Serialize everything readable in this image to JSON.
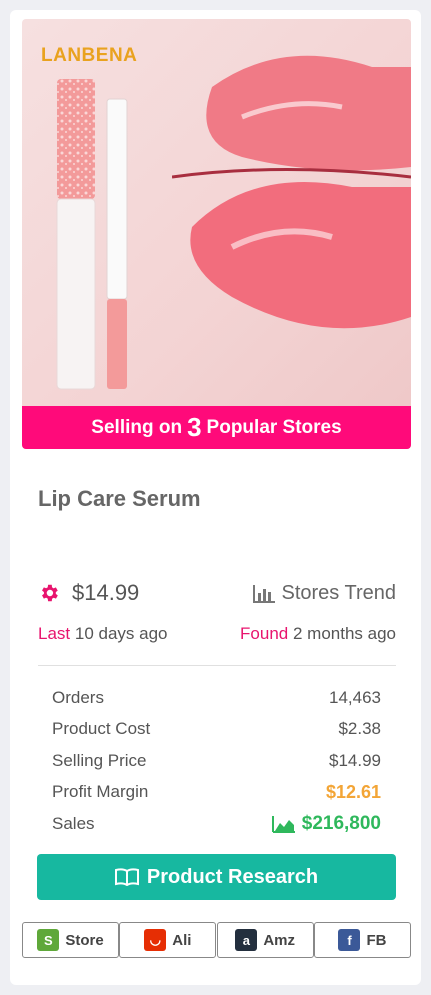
{
  "product": {
    "brand_logo": "LANBENA",
    "banner_prefix": "Selling on",
    "banner_count": "3",
    "banner_suffix": "Popular Stores",
    "title": "Lip Care Serum",
    "price": "$14.99",
    "trend_label": "Stores Trend",
    "last_label": "Last",
    "last_value": "10 days ago",
    "found_label": "Found",
    "found_value": "2 months ago"
  },
  "stats": [
    {
      "label": "Orders",
      "value": "14,463"
    },
    {
      "label": "Product Cost",
      "value": "$2.38"
    },
    {
      "label": "Selling Price",
      "value": "$14.99"
    },
    {
      "label": "Profit Margin",
      "value": "$12.61"
    },
    {
      "label": "Sales",
      "value": "$216,800"
    }
  ],
  "actions": {
    "research_label": "Product Research"
  },
  "store_links": [
    {
      "label": "Store",
      "icon": "shopify-icon",
      "color": "#5fa83a"
    },
    {
      "label": "Ali",
      "icon": "aliexpress-icon",
      "color": "#e62e04"
    },
    {
      "label": "Amz",
      "icon": "amazon-icon",
      "color": "#232f3e"
    },
    {
      "label": "FB",
      "icon": "facebook-icon",
      "color": "#3b5998"
    }
  ],
  "colors": {
    "banner": "#ff0a7a",
    "accent_pink": "#e8146e",
    "research_button": "#17b8a0",
    "profit": "#f3a536",
    "sales": "#2fb85c"
  }
}
